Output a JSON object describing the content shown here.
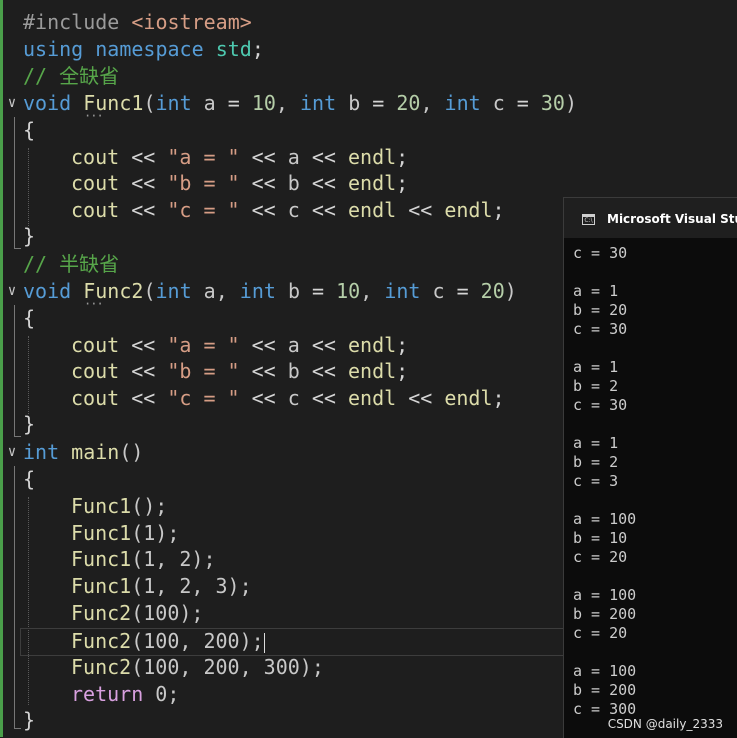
{
  "editor": {
    "line1": {
      "pp": "#include ",
      "lib": "<iostream>"
    },
    "line2": {
      "using": "using",
      "namespace": "namespace",
      "std": "std",
      "semi": ";"
    },
    "comment_full": "// 全缺省",
    "func1_sig": {
      "ret": "void",
      "name": "Func1",
      "open": "(",
      "t1": "int",
      "p1": "a",
      "eq1": " = ",
      "v1": "10",
      "sep1": ", ",
      "t2": "int",
      "p2": "b",
      "eq2": " = ",
      "v2": "20",
      "sep2": ", ",
      "t3": "int",
      "p3": "c",
      "eq3": " = ",
      "v3": "30",
      "close": ")"
    },
    "brace_open": "{",
    "brace_close": "}",
    "body_lines": [
      {
        "cout": "cout",
        "op1": " << ",
        "str": "\"a = \"",
        "op2": " << ",
        "var": "a",
        "op3": " << ",
        "endl": "endl",
        "tail": ";"
      },
      {
        "cout": "cout",
        "op1": " << ",
        "str": "\"b = \"",
        "op2": " << ",
        "var": "b",
        "op3": " << ",
        "endl": "endl",
        "tail": ";"
      },
      {
        "cout": "cout",
        "op1": " << ",
        "str": "\"c = \"",
        "op2": " << ",
        "var": "c",
        "op3": " << ",
        "endl": "endl",
        "op4": " << ",
        "endl2": "endl",
        "tail": ";"
      }
    ],
    "comment_half": "// 半缺省",
    "func2_sig": {
      "ret": "void",
      "name": "Func2",
      "open": "(",
      "t1": "int",
      "p1": "a",
      "sep1": ", ",
      "t2": "int",
      "p2": "b",
      "eq2": " = ",
      "v2": "10",
      "sep2": ", ",
      "t3": "int",
      "p3": "c",
      "eq3": " = ",
      "v3": "20",
      "close": ")"
    },
    "main_sig": {
      "ret": "int",
      "name": "main",
      "parens": "()"
    },
    "calls": [
      {
        "fn": "Func1",
        "args": "();"
      },
      {
        "fn": "Func1",
        "args": "(1);"
      },
      {
        "fn": "Func1",
        "args": "(1, 2);"
      },
      {
        "fn": "Func1",
        "args": "(1, 2, 3);"
      },
      {
        "fn": "Func2",
        "args": "(100);"
      },
      {
        "fn": "Func2",
        "args": "(100, 200);"
      },
      {
        "fn": "Func2",
        "args": "(100, 200, 300);"
      }
    ],
    "return_stmt": {
      "kw": "return",
      "val": " 0;"
    },
    "fold_glyph": "∨",
    "squiggle": "···"
  },
  "console": {
    "title": "Microsoft Visual Studio",
    "icon": "C:\\",
    "lines": [
      "c = 30",
      "",
      "a = 1",
      "b = 20",
      "c = 30",
      "",
      "a = 1",
      "b = 2",
      "c = 30",
      "",
      "a = 1",
      "b = 2",
      "c = 3",
      "",
      "a = 100",
      "b = 10",
      "c = 20",
      "",
      "a = 100",
      "b = 200",
      "c = 20",
      "",
      "a = 100",
      "b = 200",
      "c = 300"
    ]
  },
  "watermark": "CSDN @daily_2333",
  "colors": {
    "editor_bg": "#1e1e1e",
    "keyword": "#569cd6",
    "function": "#dcdcaa",
    "comment": "#57a64a",
    "number": "#b5cea8",
    "string": "#d69d85",
    "control": "#d8a0df",
    "console_bg": "#0c0c0c"
  }
}
